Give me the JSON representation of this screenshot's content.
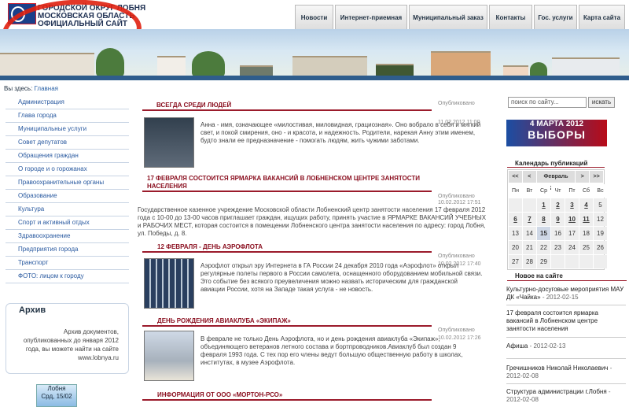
{
  "site": {
    "title_line1": "ГОРОДСКОЙ ОКРУГ ЛОБНЯ",
    "title_line2": "МОСКОВСКАЯ ОБЛАСТЬ",
    "title_line3": "ОФИЦИАЛЬНЫЙ САЙТ"
  },
  "nav": {
    "tabs": [
      {
        "label": "Новости"
      },
      {
        "label": "Интернет-приемная"
      },
      {
        "label": "Муниципальный заказ"
      },
      {
        "label": "Контакты"
      },
      {
        "label": "Гос. услуги"
      },
      {
        "label": "Карта сайта"
      }
    ]
  },
  "breadcrumb": {
    "prefix": "Вы здесь:",
    "current": "Главная"
  },
  "sidebar": {
    "items": [
      {
        "label": "Администрация"
      },
      {
        "label": "Глава города"
      },
      {
        "label": "Муниципальные услуги"
      },
      {
        "label": "Совет депутатов"
      },
      {
        "label": "Обращения граждан"
      },
      {
        "label": "О городе и о горожанах"
      },
      {
        "label": "Правоохранительные органы"
      },
      {
        "label": "Образование"
      },
      {
        "label": "Культура"
      },
      {
        "label": "Спорт и активный отдых"
      },
      {
        "label": "Здравоохранение"
      },
      {
        "label": "Предприятия города"
      },
      {
        "label": "Транспорт"
      },
      {
        "label": "ФОТО: лицом к городу"
      }
    ]
  },
  "archive": {
    "title": "Архив",
    "text": "Архив документов, опубликованных до января 2012 года, вы можете найти на сайте www.lobnya.ru"
  },
  "widget": {
    "city": "Лобня",
    "date": "Срд, 15/02"
  },
  "articles": [
    {
      "title": "ВСЕГДА СРЕДИ ЛЮДЕЙ",
      "published_label": "Опубликовано",
      "date": "11.02.2012 11:00",
      "text": "Анна - имя, означающее «милостивая, миловидная, грациозная». Оно вобрало в себя и мягкий свет, и покой смирения, оно - и красота, и надежность. Родители, нарекая Анну этим именем, будто знали ее предназначение - помогать людям, жить чужими заботами."
    },
    {
      "title_line1": "17 ФЕВРАЛЯ СОСТОИТСЯ ЯРМАРКА ВАКАНСИЙ В ЛОБНЕНСКОМ ЦЕНТРЕ ЗАНЯТОСТИ",
      "title_line2": "НАСЕЛЕНИЯ",
      "published_label": "Опубликовано",
      "date": "10.02.2012 17:51",
      "text": "Государственное казенное учреждение Московской области Лобненский центр занятости населения 17 февраля 2012 года с 10-00 до 13-00 часов приглашает граждан, ищущих работу, принять участие в ЯРМАРКЕ ВАКАНСИЙ УЧЕБНЫХ и РАБОЧИХ МЕСТ, которая состоится в помещении Лобненского центра занятости населения по адресу: город Лобня, ул. Победы, д. 8."
    },
    {
      "title": "12 ФЕВРАЛЯ - ДЕНЬ АЭРОФЛОТА",
      "published_label": "Опубликовано",
      "date": "10.02.2012 17:40",
      "text": "Аэрофлот открыл эру Интернета в ГА России 24 декабря 2010 года «Аэрофлот» открыл регулярные полеты первого в России самолета, оснащенного оборудованием мобильной связи. Это событие без всякого преувеличения можно назвать историческим для гражданской авиации России, хотя на Западе такая услуга - не новость."
    },
    {
      "title": "ДЕНЬ РОЖДЕНИЯ АВИАКЛУБА «ЭКИПАЖ»",
      "published_label": "Опубликовано",
      "date": "10.02.2012 17:26",
      "text": "В феврале не только День Аэрофлота, но и день рождения авиаклуба «Экипаж», объединяющего ветеранов летного состава и бортпроводников.Авиаклуб был создан 9 февраля 1993 года. С тех пор его члены ведут большую общественную работу в школах, институтах, в музее Аэрофлота."
    },
    {
      "title": "ИНФОРМАЦИЯ ОТ ООО «МОРТОН-РСО»"
    }
  ],
  "search": {
    "placeholder": "поиск по сайту...",
    "button": "искать"
  },
  "elections": {
    "date": "4 МАРТА 2012",
    "label": "ВЫБОРЫ"
  },
  "calendar": {
    "title": "Календарь публикаций",
    "prev_year": "<<",
    "prev_month": "<",
    "month": "Февраль 2012",
    "next_month": ">",
    "next_year": ">>",
    "weekdays": [
      "Пн",
      "Вт",
      "Ср",
      "Чт",
      "Пт",
      "Сб",
      "Вс"
    ],
    "weeks": [
      [
        "",
        "",
        "1",
        "2",
        "3",
        "4",
        "5"
      ],
      [
        "6",
        "7",
        "8",
        "9",
        "10",
        "11",
        "12"
      ],
      [
        "13",
        "14",
        "15",
        "16",
        "17",
        "18",
        "19"
      ],
      [
        "20",
        "21",
        "22",
        "23",
        "24",
        "25",
        "26"
      ],
      [
        "27",
        "28",
        "29",
        "",
        "",
        "",
        ""
      ]
    ],
    "linked_days": [
      "1",
      "2",
      "3",
      "4",
      "6",
      "7",
      "8",
      "9",
      "10",
      "11"
    ],
    "today": "15"
  },
  "news": {
    "title": "Новое на сайте",
    "items": [
      {
        "title": "Культурно-досуговые мероприятия МАУ ДК «Чайка»",
        "date": "- 2012-02-15"
      },
      {
        "title": "17 февраля состоится ярмарка вакансий в Лобненском центре занятости населения",
        "date": ""
      },
      {
        "title": "Афиша",
        "date": "- 2012-02-13"
      },
      {
        "title": "Гречишников Николай Николаевич",
        "date": "- 2012-02-08"
      },
      {
        "title": "Структура администрации г.Лобня",
        "date": "- 2012-02-08"
      }
    ]
  }
}
